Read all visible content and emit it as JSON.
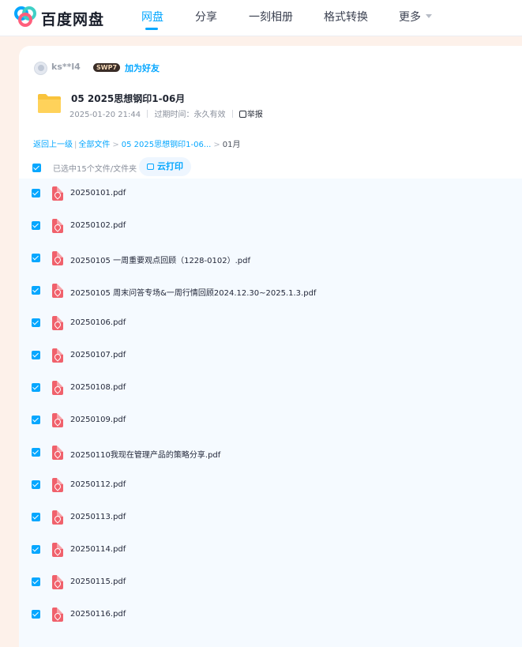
{
  "brand": {
    "logo_text": "百度网盘",
    "accent": "#06a7ff"
  },
  "nav": {
    "items": [
      {
        "label": "网盘",
        "active": true
      },
      {
        "label": "分享",
        "active": false
      },
      {
        "label": "一刻相册",
        "active": false
      },
      {
        "label": "格式转换",
        "active": false
      },
      {
        "label": "更多",
        "active": false
      }
    ]
  },
  "share": {
    "user": "ks**l4",
    "badge": "SWP7",
    "add_friend": "加为好友",
    "title": "05 2025思想钢印1-06月",
    "date": "2025-01-20 21:44",
    "expiry_label": "过期时间：永久有效",
    "report": "举报"
  },
  "breadcrumb": {
    "back": "返回上一级",
    "all_files": "全部文件",
    "folder": "05 2025思想钢印1-06...",
    "current": "01月"
  },
  "selection": {
    "text": "已选中15个文件/文件夹",
    "print_label": "云打印"
  },
  "files": [
    "20250101.pdf",
    "20250102.pdf",
    "20250105 一周重要观点回顾（1228-0102）.pdf",
    "20250105 周末问答专场&一周行情回顾2024.12.30~2025.1.3.pdf",
    "20250106.pdf",
    "20250107.pdf",
    "20250108.pdf",
    "20250109.pdf",
    "20250110我现在管理产品的策略分享.pdf",
    "20250112.pdf",
    "20250113.pdf",
    "20250114.pdf",
    "20250115.pdf",
    "20250116.pdf"
  ]
}
